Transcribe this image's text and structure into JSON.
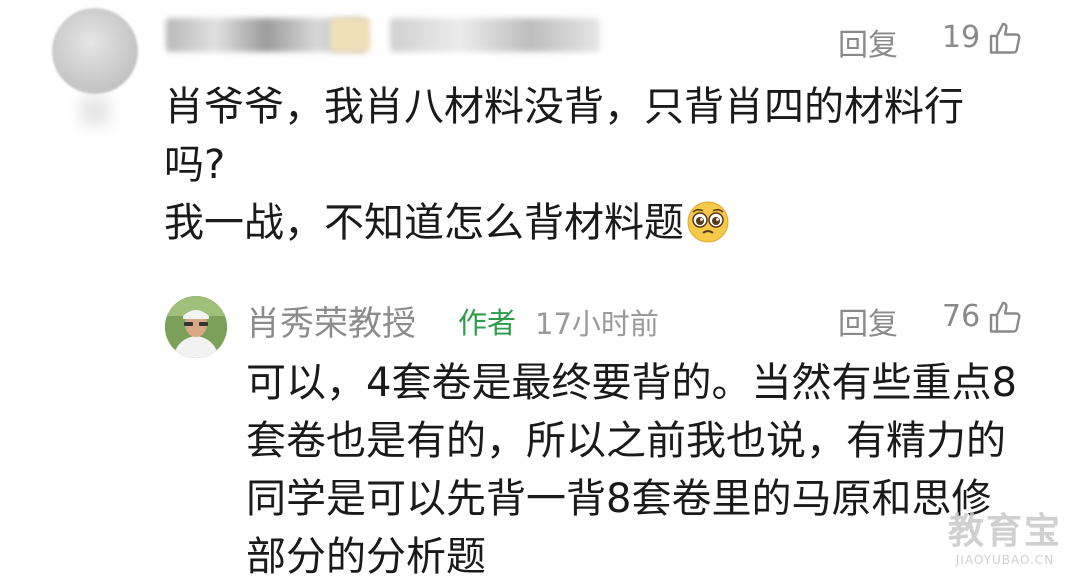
{
  "comment": {
    "reply_label": "回复",
    "likes": "19",
    "lines": [
      "肖爷爷，我肖八材料没背，只背肖四的材料行",
      "吗?",
      "我一战，不知道怎么背材料题"
    ],
    "emoji_icon": "pleading-face-icon"
  },
  "reply": {
    "author_name": "肖秀荣教授",
    "author_tag": "作者",
    "time": "17小时前",
    "reply_label": "回复",
    "likes": "76",
    "lines": [
      "可以，4套卷是最终要背的。当然有些重点8",
      "套卷也是有的，所以之前我也说，有精力的",
      "同学是可以先背一背8套卷里的马原和思修",
      "部分的分析题"
    ]
  },
  "watermark": {
    "main": "教育宝",
    "sub": "JIAOYUBAO.CN"
  },
  "colors": {
    "author_tag": "#2e9d4b",
    "meta_gray": "#8a8a8a",
    "text": "#1a1a1a"
  }
}
